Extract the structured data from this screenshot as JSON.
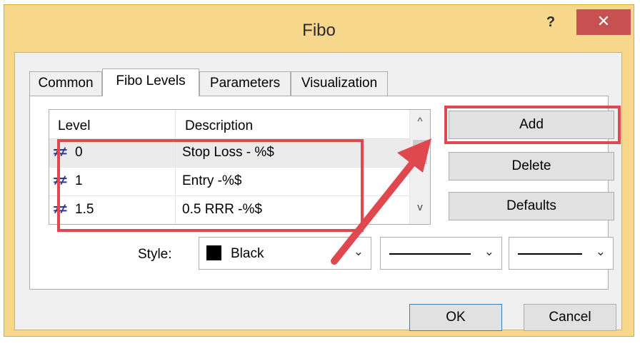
{
  "window": {
    "title": "Fibo",
    "help_label": "?",
    "close_label": "✕",
    "close_color": "#c75050",
    "frame_color": "#f7d78c"
  },
  "tabs": [
    {
      "label": "Common",
      "active": false
    },
    {
      "label": "Fibo Levels",
      "active": true
    },
    {
      "label": "Parameters",
      "active": false
    },
    {
      "label": "Visualization",
      "active": false
    }
  ],
  "levels_table": {
    "columns": [
      "Level",
      "Description"
    ],
    "rows": [
      {
        "icon": "level-line-icon",
        "level": "0",
        "description": "Stop Loss - %$",
        "selected": true
      },
      {
        "icon": "level-line-icon",
        "level": "1",
        "description": "Entry -%$",
        "selected": false
      },
      {
        "icon": "level-line-icon",
        "level": "1.5",
        "description": "0.5 RRR -%$",
        "selected": false
      }
    ],
    "scroll_up": "^",
    "scroll_down": "v"
  },
  "side_buttons": {
    "add": "Add",
    "delete": "Delete",
    "defaults": "Defaults"
  },
  "style_row": {
    "label": "Style:",
    "color_value": "Black",
    "color_swatch": "#000000",
    "line_style_icon": "solid-line",
    "line_width_icon": "solid-line"
  },
  "dialog_buttons": {
    "ok": "OK",
    "cancel": "Cancel"
  },
  "annotation": {
    "highlight_color": "#e0484f"
  }
}
